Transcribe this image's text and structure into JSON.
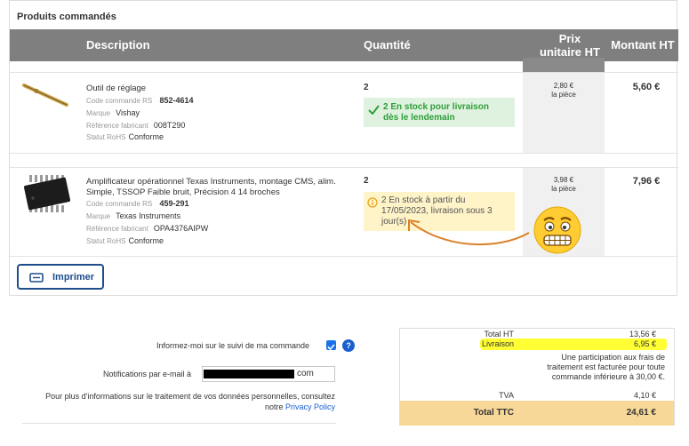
{
  "section_title": "Produits commandés",
  "table": {
    "headers": {
      "description": "Description",
      "quantity": "Quantité",
      "unit_price_line1": "Prix",
      "unit_price_line2": "unitaire HT",
      "total": "Montant HT"
    },
    "rows": [
      {
        "name": "Outil de réglage",
        "code_label": "Code commande RS",
        "code_value": "852-4614",
        "brand_label": "Marque",
        "brand_value": "Vishay",
        "ref_label": "Référence fabricant",
        "ref_value": "008T290",
        "rohs_label": "Statut RoHS",
        "rohs_value": "Conforme",
        "quantity": "2",
        "stock_line1": "2 En stock pour livraison",
        "stock_line2": "dès le lendemain",
        "unit_price": "2,80 €",
        "unit_label": "la pièce",
        "line_total": "5,60 €"
      },
      {
        "name_line1": "Amplificateur opérationnel Texas Instruments, montage CMS, alim.",
        "name_line2": "Simple, TSSOP Faible bruit, Précision 4 14 broches",
        "code_label": "Code commande RS",
        "code_value": "459-291",
        "brand_label": "Marque",
        "brand_value": "Texas Instruments",
        "ref_label": "Référence fabricant",
        "ref_value": "OPA4376AIPW",
        "rohs_label": "Statut RoHS",
        "rohs_value": "Conforme",
        "quantity": "2",
        "stock_line1": "2 En stock à partir du",
        "stock_line2": "17/05/2023, livraison sous 3",
        "stock_line3": "jour(s)",
        "unit_price": "3,98 €",
        "unit_label": "la pièce",
        "line_total": "7,96 €"
      }
    ]
  },
  "print_button": "Imprimer",
  "options": {
    "follow_label": "Informez-moi sur le suivi de ma commande",
    "help_glyph": "?",
    "email_label": "Notifications par e-mail à",
    "email_suffix": "com",
    "privacy_line1": "Pour plus d'informations sur le traitement de vos données personnelles, consultez",
    "privacy_prefix": "notre",
    "privacy_link": "Privacy Policy"
  },
  "totals": {
    "ht_label": "Total HT",
    "ht_value": "13,56 €",
    "delivery_label": "Livraison",
    "delivery_value": "6,95 €",
    "note_line1": "Une participation aux frais de",
    "note_line2": "traitement est facturée pour toute",
    "note_line3": "commande inférieure à 30,00 €.",
    "tva_label": "TVA",
    "tva_value": "4,10 €",
    "ttc_label": "Total TTC",
    "ttc_value": "24,61 €"
  },
  "colors": {
    "header_bg": "#7f7f7f",
    "stock_green": "#2e9e3a",
    "stock_amber_bg": "#fff3c8",
    "primary_blue": "#1d4d8a",
    "highlight_yellow": "#ffff33",
    "ttc_bg": "#f8d898",
    "annotation_arrow": "#d9822b"
  },
  "icons": [
    "check-icon",
    "info-icon",
    "printer-icon",
    "help-icon",
    "grimace-emoji-icon",
    "curved-arrow-icon"
  ]
}
